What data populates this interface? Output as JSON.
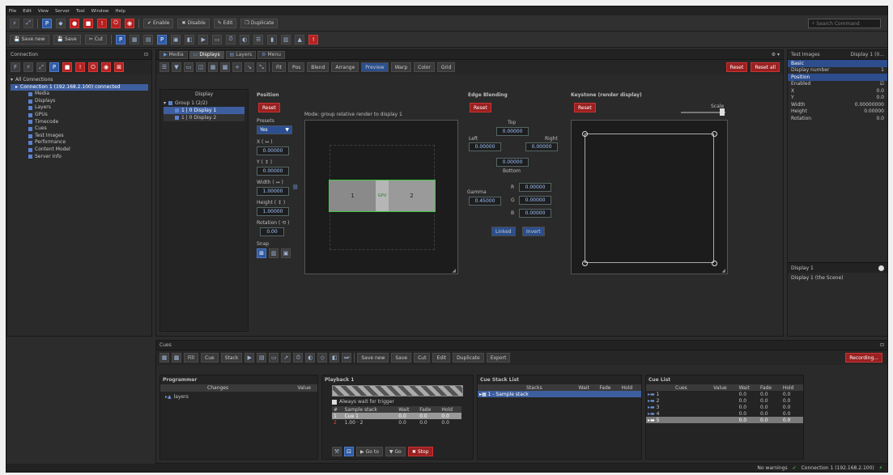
{
  "menu": [
    "File",
    "Edit",
    "View",
    "Server",
    "Tool",
    "Window",
    "Help"
  ],
  "toolbar1": {
    "buttons": [
      "Enable",
      "Disable",
      "Edit",
      "Duplicate"
    ],
    "search_placeholder": "Search Command"
  },
  "toolbar2": {
    "buttons": [
      "Save new",
      "Save",
      "Cut"
    ]
  },
  "connections": {
    "title": "Connection",
    "root": "All Connections",
    "connection": "Connection 1 (192.168.2.100) connected",
    "items": [
      "Media",
      "Displays",
      "Layers",
      "GPUs",
      "Timecode",
      "Cues",
      "Test Images",
      "Performance",
      "Content Model",
      "Server Info"
    ]
  },
  "tabs": [
    "Media",
    "Displays",
    "Layers",
    "Menu"
  ],
  "subtoolbar": [
    "Fit",
    "Pos",
    "Blend",
    "Arrange",
    "Warp",
    "Color",
    "Grid",
    "Reset",
    "Reset all",
    "Preview"
  ],
  "displays_list": {
    "header": "Display",
    "group": "Group 1 (2/2)",
    "items": [
      "1 | 0 Display 1",
      "1 | 0 Display 2"
    ]
  },
  "position": {
    "title": "Position",
    "reset": "Reset",
    "preset_label": "Presets",
    "preset_value": "Yes",
    "fields": [
      {
        "label": "X ( ↔ )",
        "value": "0.00000"
      },
      {
        "label": "Y ( ↕ )",
        "value": "0.00000"
      },
      {
        "label": "Width ( ↔ )",
        "value": "1.00000"
      },
      {
        "label": "Height ( ↕ )",
        "value": "1.00000"
      },
      {
        "label": "Rotation ( ⟲ )",
        "value": "0.00"
      }
    ],
    "snap": "Snap",
    "canvas_label": "Mode: group relative render to display 1",
    "disp1": "1",
    "disp2": "2",
    "mid": "GPU"
  },
  "edge": {
    "title": "Edge Blending",
    "reset": "Reset",
    "top": "Top",
    "top_value": "0.00000",
    "left": "Left",
    "left_value": "0.00000",
    "right": "Right",
    "right_value": "0.00000",
    "bottom": "Bottom",
    "bottom_value": "0.00000",
    "gamma": "Gamma",
    "gamma_value": "0.45000",
    "r": "R",
    "g": "G",
    "b": "B",
    "r_value": "0.00000",
    "g_value": "0.00000",
    "b_value": "0.00000",
    "linked": "Linked",
    "invert": "Invert"
  },
  "keystone": {
    "title": "Keystone (render display)",
    "reset": "Reset",
    "scale": "Scale"
  },
  "testimages": {
    "title": "Test Images",
    "display": "Display 1 (0...",
    "basic": "Basic",
    "display_number_label": "Display number",
    "display_number": "1",
    "position": "Position",
    "props": [
      {
        "k": "Enabled",
        "v": "☑"
      },
      {
        "k": "X",
        "v": "0.0"
      },
      {
        "k": "Y",
        "v": "0.0"
      },
      {
        "k": "Width",
        "v": "0.00000000"
      },
      {
        "k": "Height",
        "v": "0.00000"
      },
      {
        "k": "Rotation",
        "v": "0.0"
      }
    ],
    "desc_title": "Display 1",
    "desc_text": "Display 1 (the Scene)"
  },
  "cues": {
    "title": "Cues",
    "toolbar": [
      "Fill",
      "Cue",
      "Stack",
      "Save new",
      "Save",
      "Cut",
      "Edit",
      "Duplicate",
      "Export",
      "Recording..."
    ],
    "programmer": {
      "title": "Programmer",
      "cols": [
        "Changes",
        "Value"
      ],
      "row": "layers"
    },
    "playback": {
      "title": "Playback 1",
      "always": "Always wait for trigger",
      "cols": [
        "#",
        "Sample stack",
        "Wait",
        "Fade",
        "Hold"
      ],
      "rows": [
        [
          "1",
          "Cue 1",
          "0.0",
          "0.0",
          "0.0"
        ],
        [
          "2",
          "1.00 · 2",
          "0.0",
          "0.0",
          "0.0"
        ]
      ],
      "go": "Go to",
      "go2": "Go",
      "stop": "Stop"
    },
    "cuestack": {
      "title": "Cue Stack List",
      "cols": [
        "Stacks",
        "Wait",
        "Fade",
        "Hold"
      ],
      "row": "1 - Sample stack"
    },
    "cuelist": {
      "title": "Cue List",
      "cols": [
        "Cues",
        "Value",
        "Wait",
        "Fade",
        "Hold"
      ],
      "rows": [
        [
          "1",
          "",
          "0.0",
          "0.0",
          "0.0"
        ],
        [
          "2",
          "",
          "0.0",
          "0.0",
          "0.0"
        ],
        [
          "3",
          "",
          "0.0",
          "0.0",
          "0.0"
        ],
        [
          "4",
          "",
          "0.0",
          "0.0",
          "0.0"
        ],
        [
          "5",
          "",
          "0.0",
          "0.0",
          "0.0"
        ]
      ]
    }
  },
  "status": {
    "warnings": "No warnings",
    "connection": "Connection 1 (192.168.2.100)"
  }
}
